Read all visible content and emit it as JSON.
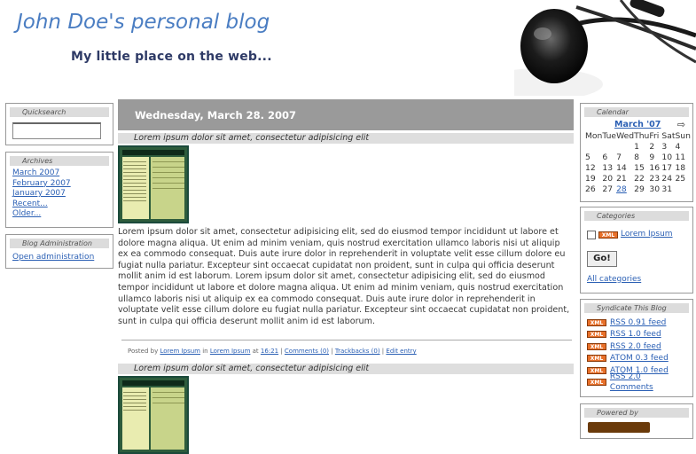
{
  "header": {
    "title": "John Doe's personal blog",
    "tagline": "My little place on the web..."
  },
  "quicksearch": {
    "title": "Quicksearch",
    "value": ""
  },
  "archives": {
    "title": "Archives",
    "links": [
      "March 2007",
      "February 2007",
      "January 2007",
      "Recent...",
      "Older..."
    ]
  },
  "admin": {
    "title": "Blog Administration",
    "link": "Open administration"
  },
  "main": {
    "date": "Wednesday, March 28. 2007",
    "entries": [
      {
        "title": "Lorem ipsum dolor sit amet, consectetur adipisicing elit",
        "body": "Lorem ipsum dolor sit amet, consectetur adipisicing elit, sed do eiusmod tempor incididunt ut labore et dolore magna aliqua. Ut enim ad minim veniam, quis nostrud exercitation ullamco laboris nisi ut aliquip ex ea commodo consequat. Duis aute irure dolor in reprehenderit in voluptate velit esse cillum dolore eu fugiat nulla pariatur. Excepteur sint occaecat cupidatat non proident, sunt in culpa qui officia deserunt mollit anim id est laborum. Lorem ipsum dolor sit amet, consectetur adipisicing elit, sed do eiusmod tempor incididunt ut labore et dolore magna aliqua. Ut enim ad minim veniam, quis nostrud exercitation ullamco laboris nisi ut aliquip ex ea commodo consequat. Duis aute irure dolor in reprehenderit in voluptate velit esse cillum dolore eu fugiat nulla pariatur. Excepteur sint occaecat cupidatat non proident, sunt in culpa qui officia deserunt mollit anim id est laborum.",
        "footer": {
          "posted_by": "Posted by",
          "author": "Lorem Ipsum",
          "in": "in",
          "category": "Lorem Ipsum",
          "at": "at",
          "time": "16:21",
          "comments": "Comments (0)",
          "trackbacks": "Trackbacks (0)",
          "edit": "Edit entry"
        }
      },
      {
        "title": "Lorem ipsum dolor sit amet, consectetur adipisicing elit"
      }
    ]
  },
  "calendar": {
    "title": "Calendar",
    "month": "March '07",
    "next_arrow": "⇨",
    "weekdays": [
      "Mon",
      "Tue",
      "Wed",
      "Thu",
      "Fri",
      "Sat",
      "Sun"
    ],
    "weeks": [
      [
        "",
        "",
        "",
        "1",
        "2",
        "3",
        "4"
      ],
      [
        "5",
        "6",
        "7",
        "8",
        "9",
        "10",
        "11"
      ],
      [
        "12",
        "13",
        "14",
        "15",
        "16",
        "17",
        "18"
      ],
      [
        "19",
        "20",
        "21",
        "22",
        "23",
        "24",
        "25"
      ],
      [
        "26",
        "27",
        "28",
        "29",
        "30",
        "31",
        ""
      ]
    ],
    "linked_day": "28"
  },
  "categories": {
    "title": "Categories",
    "xml_badge": "XML",
    "item": "Lorem Ipsum",
    "go_label": "Go!",
    "all_link": "All categories"
  },
  "syndicate": {
    "title": "Syndicate This Blog",
    "xml_badge": "XML",
    "feeds": [
      "RSS 0.91 feed",
      "RSS 1.0 feed",
      "RSS 2.0 feed",
      "ATOM 0.3 feed",
      "ATOM 1.0 feed",
      "RSS 2.0 Comments"
    ]
  },
  "powered": {
    "title": "Powered by"
  },
  "colors": {
    "title_blue": "#4a7dc2",
    "tagline_navy": "#2e3a66",
    "date_bar": "#9a9a9a",
    "xml_orange": "#e8702a"
  }
}
